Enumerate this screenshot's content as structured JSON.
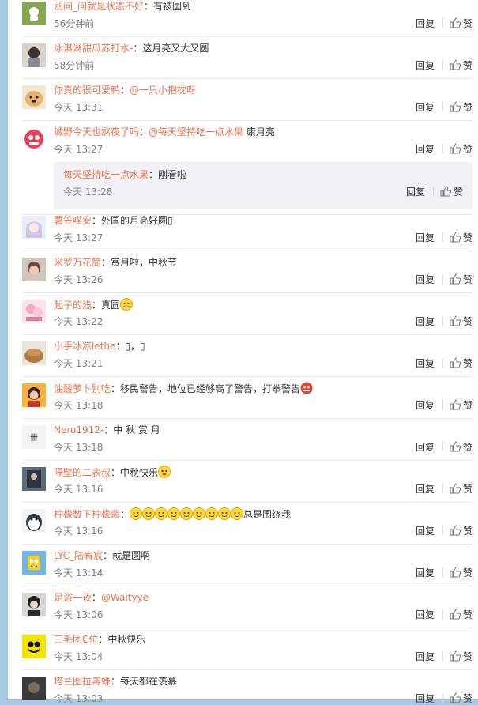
{
  "actions": {
    "reply": "回复",
    "like": "赞"
  },
  "comments": [
    {
      "user": "别问_问就是状态不好",
      "text": "：有被圆到",
      "time": "56分钟前"
    },
    {
      "user": "冰淇淋甜瓜苏打水-",
      "text": "：这月亮又大又圆",
      "time": "58分钟前"
    },
    {
      "user": "你真的很可爱鸭",
      "text": "：",
      "mention": "@一只小抱枕呀",
      "time": "今天 13:31"
    },
    {
      "user": "城野今天也熬夜了吗",
      "text": "：",
      "mention": "@每天坚持吃一点水果",
      "text2": " 康月亮",
      "time": "今天 13:27",
      "reply": {
        "user": "每天坚持吃一点水果",
        "text": "：刚看啦",
        "time": "今天 13:28"
      }
    },
    {
      "user": "薯笠喵安",
      "text": "：外国的月亮好圆▯",
      "time": "今天 13:27"
    },
    {
      "user": "米罗万花筒",
      "text": "：赏月啦，中秋节",
      "time": "今天 13:26"
    },
    {
      "user": "起子的浅",
      "text": "：真圆",
      "time": "今天 13:22"
    },
    {
      "user": "小手冰凉lethe",
      "text": "：▯，▯",
      "time": "今天 13:21"
    },
    {
      "user": "油酸萝卜别吃",
      "text": "：移民警告，地位已经够高了警告，打拳警告",
      "time": "今天 13:18"
    },
    {
      "user": "Nero1912-",
      "text": "：中 秋 赏 月",
      "time": "今天 13:18"
    },
    {
      "user": "隔壁的二表叔",
      "text": "：中秋快乐",
      "time": "今天 13:16"
    },
    {
      "user": "柠檬数下柠檬酱",
      "text": "：",
      "text2": "总是围绕我",
      "time": "今天 13:16"
    },
    {
      "user": "LYC_陆宥宸",
      "text": "：就是圆啊",
      "time": "今天 13:14"
    },
    {
      "user": "足浴一夜",
      "text": "：",
      "mention": "@Waityye",
      "time": "今天 13:06"
    },
    {
      "user": "三毛团C位",
      "text": "：中秋快乐",
      "time": "今天 13:04"
    },
    {
      "user": "塔兰图拉毒蛛",
      "text": "：每天都在羡慕",
      "time": "今天 13:03"
    }
  ]
}
